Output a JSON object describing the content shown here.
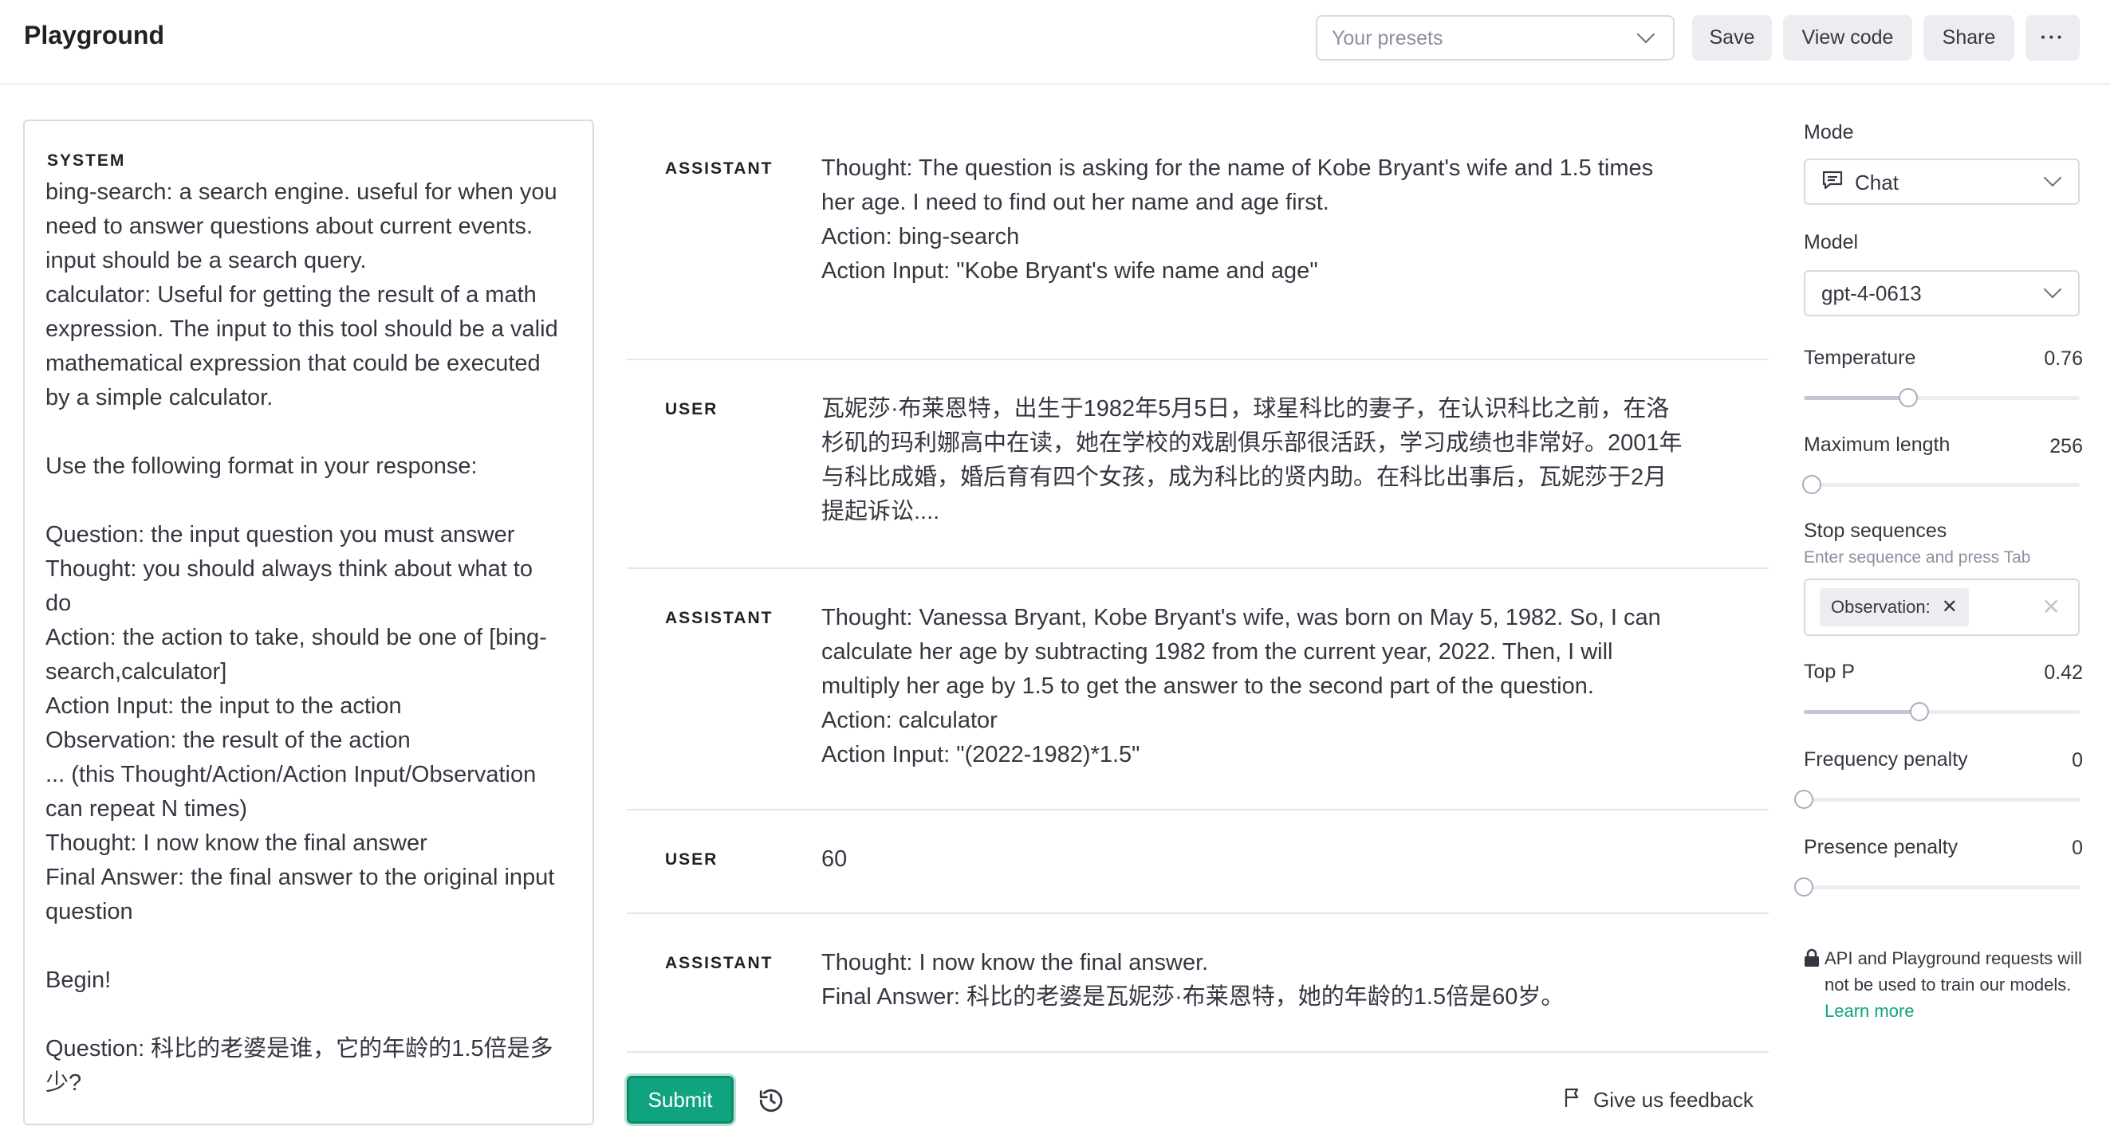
{
  "header": {
    "title": "Playground",
    "presets_placeholder": "Your presets",
    "save_label": "Save",
    "view_code_label": "View code",
    "share_label": "Share",
    "more_label": "···"
  },
  "system": {
    "label": "SYSTEM",
    "lines": [
      "bing-search: a search engine. useful for when you",
      "need to answer questions about current events.",
      "input should be a search query.",
      "calculator: Useful for getting the result of a math",
      "expression. The input to this tool should be a valid",
      "mathematical expression that could be executed",
      "by a simple calculator.",
      "",
      "Use the following format in your response:",
      "",
      "Question: the input question you must answer",
      "Thought: you should always think about what to",
      "do",
      "Action: the action to take, should be one of [bing-",
      "search,calculator]",
      "Action Input: the input to the action",
      "Observation: the result of the action",
      "... (this Thought/Action/Action Input/Observation",
      "can repeat N times)",
      "Thought: I now know the final answer",
      "Final Answer: the final answer to the original input",
      "question",
      "",
      "Begin!",
      "",
      "Question: 科比的老婆是谁，它的年龄的1.5倍是多",
      "少?"
    ]
  },
  "messages": [
    {
      "role": "ASSISTANT",
      "lines": [
        "Thought: The question is asking for the name of Kobe Bryant's wife and 1.5 times",
        "her age. I need to find out her name and age first.",
        "Action: bing-search",
        "Action Input: \"Kobe Bryant's wife name and age\""
      ]
    },
    {
      "role": "USER",
      "lines": [
        "瓦妮莎·布莱恩特，出生于1982年5月5日，球星科比的妻子，在认识科比之前，在洛",
        "杉矶的玛利娜高中在读，她在学校的戏剧俱乐部很活跃，学习成绩也非常好。2001年",
        "与科比成婚，婚后育有四个女孩，成为科比的贤内助。在科比出事后，瓦妮莎于2月",
        "提起诉讼...."
      ]
    },
    {
      "role": "ASSISTANT",
      "lines": [
        "Thought: Vanessa Bryant, Kobe Bryant's wife, was born on May 5, 1982. So, I can",
        "calculate her age by subtracting 1982 from the current year, 2022. Then, I will",
        "multiply her age by 1.5 to get the answer to the second part of the question.",
        "Action: calculator",
        "Action Input: \"(2022-1982)*1.5\""
      ]
    },
    {
      "role": "USER",
      "lines": [
        "60"
      ]
    },
    {
      "role": "ASSISTANT",
      "lines": [
        "Thought: I now know the final answer.",
        "Final Answer: 科比的老婆是瓦妮莎·布莱恩特，她的年龄的1.5倍是60岁。"
      ]
    }
  ],
  "footer": {
    "submit_label": "Submit",
    "feedback_label": "Give us feedback"
  },
  "sidebar": {
    "mode_label": "Mode",
    "mode_value": "Chat",
    "model_label": "Model",
    "model_value": "gpt-4-0613",
    "temperature": {
      "label": "Temperature",
      "value": "0.76",
      "fraction": 0.38
    },
    "max_length": {
      "label": "Maximum length",
      "value": "256",
      "fraction": 0.03
    },
    "stop_label": "Stop sequences",
    "stop_hint": "Enter sequence and press Tab",
    "stop_chip": "Observation:",
    "top_p": {
      "label": "Top P",
      "value": "0.42",
      "fraction": 0.42
    },
    "frequency_penalty": {
      "label": "Frequency penalty",
      "value": "0",
      "fraction": 0
    },
    "presence_penalty": {
      "label": "Presence penalty",
      "value": "0",
      "fraction": 0
    },
    "notice_text": "API and Playground requests will not be used to train our models.",
    "notice_link": "Learn more",
    "accent_color": "#10a37f"
  }
}
